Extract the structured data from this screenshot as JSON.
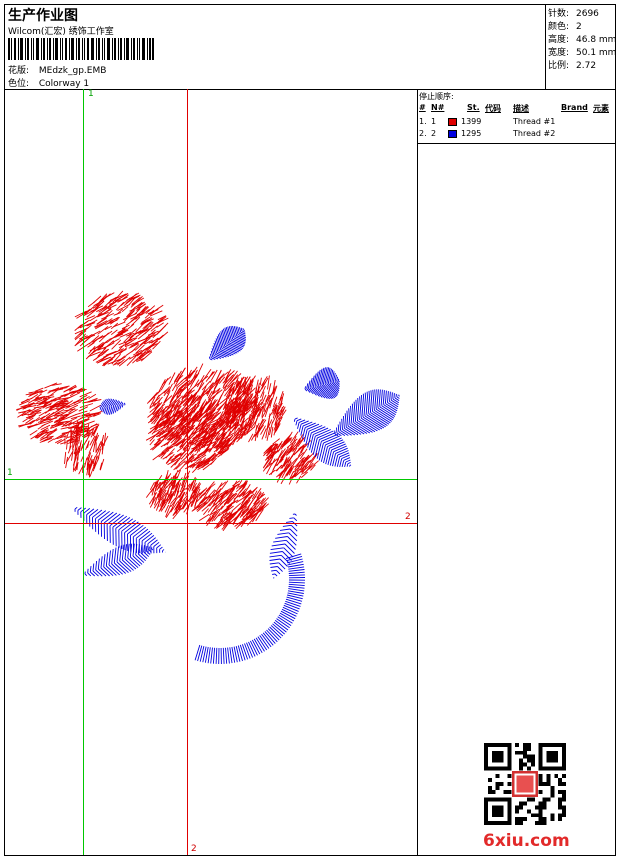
{
  "header": {
    "title": "生产作业图",
    "subtitle": "Wilcom(汇宏) 绣饰工作室",
    "design_file_label": "花版:",
    "design_file": "MEdzk_gp.EMB",
    "colorway_label": "色位:",
    "colorway": "Colorway 1"
  },
  "stats": [
    {
      "label": "针数:",
      "value": "2696"
    },
    {
      "label": "颜色:",
      "value": "2"
    },
    {
      "label": "高度:",
      "value": "46.8 mm"
    },
    {
      "label": "宽度:",
      "value": "50.1 mm"
    },
    {
      "label": "比例:",
      "value": "2.72"
    }
  ],
  "guides": {
    "green_v_label": "1",
    "green_h_label": "1",
    "red_h_label": "2",
    "red_v_label": "2"
  },
  "stop_sequence": {
    "title": "停止顺序:",
    "headers": [
      "#",
      "N#",
      "St.",
      "代码",
      "描述",
      "Brand",
      "元素"
    ],
    "rows": [
      {
        "num": "1.",
        "n": "1",
        "color": "#e00000",
        "st": "1399",
        "desc": "Thread #1"
      },
      {
        "num": "2.",
        "n": "2",
        "color": "#0000e0",
        "st": "1295",
        "desc": "Thread #2"
      }
    ]
  },
  "colors": {
    "thread1": "#e00000",
    "thread2": "#0000e0"
  },
  "watermark": "6xiu.com"
}
